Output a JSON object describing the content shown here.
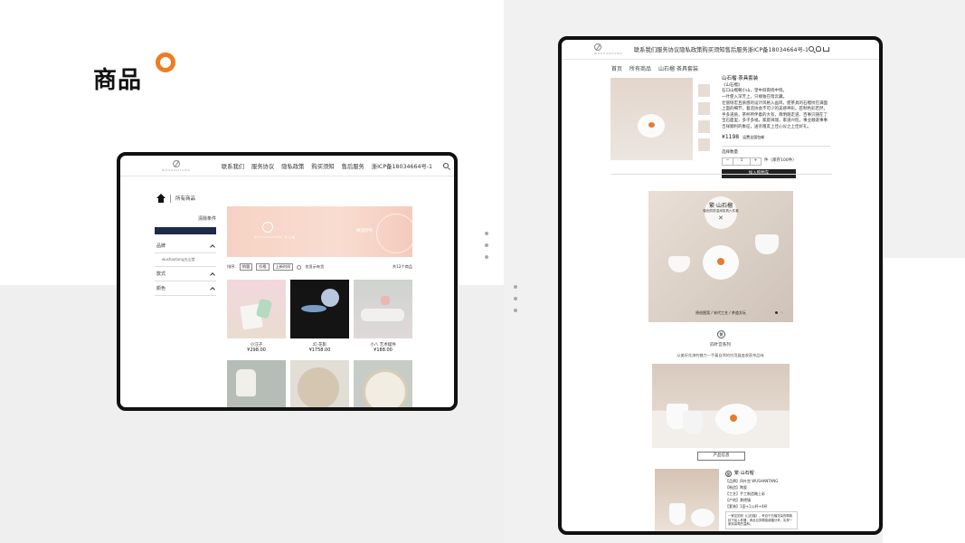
{
  "section": {
    "title": "商品"
  },
  "nav": {
    "brand": "WUSHANTANG",
    "links": [
      "联系我们",
      "服务协议",
      "隐私政策",
      "购买须知",
      "售后服务",
      "浙ICP备18034664号-1"
    ],
    "icons": [
      "search-icon",
      "user-icon",
      "cart-icon"
    ]
  },
  "listing": {
    "breadcrumb": "所有商品",
    "sidebar": {
      "clear_label": "清除条件",
      "groups": [
        {
          "label": "品牌",
          "items": [
            "wushantang五山堂"
          ]
        },
        {
          "label": "款式",
          "items": []
        },
        {
          "label": "颜色",
          "items": []
        }
      ]
    },
    "banner": {
      "tag": "WUSHANTANG 五山堂",
      "text": "精选好物"
    },
    "filters": {
      "sort_label": "排序:",
      "options": [
        "销量",
        "价格",
        "上新时间"
      ],
      "stock_label": "仅显示有货",
      "count": "共12个商品"
    },
    "products": [
      {
        "name": "小汪子",
        "price": "¥298.00"
      },
      {
        "name": "幻·花影",
        "price": "¥1758.00"
      },
      {
        "name": "小八 艺术摆件",
        "price": "¥188.00"
      },
      {
        "name": "",
        "price": ""
      },
      {
        "name": "",
        "price": ""
      },
      {
        "name": "",
        "price": ""
      }
    ]
  },
  "detail": {
    "breadcrumb": [
      "首页",
      "所有商品",
      "山石榴 茶具套装"
    ],
    "title": "山石榴·茶具套装",
    "subtitle": "《山石榴》",
    "lines": [
      "石口山榴朝小山，望中斜雨绕中残。",
      "一叶使入深芳上，只缘独在暗云藏。"
    ],
    "description": "壮丽恢宏且质感的设计风格入画风，使茶具的石榴纹在满面上面的细节，着造协会不可少的美感神彩。匠制色彩若然，手多道质，茶杯所伴着的大有，简明随走道，百事只随在了宝石面里，多子多福，家庭祥瑞，家道兴旺，事业顺遂事事吉祥顺利的象征，送亲赠友上佳心仪之上佳好礼。",
    "price": "¥1198",
    "price_note": "运费全国包邮",
    "qty_label": "选择数量",
    "qty_minus": "−",
    "qty_value": "1",
    "qty_plus": "+",
    "stock": "件（库存100件）",
    "add_to_cart": "加入购物车",
    "hero": {
      "logo_char": "繁",
      "title": "繁·山石榴",
      "subtitle": "釉色丽质温润茶具六件套",
      "close": "✕",
      "caption": "原创图案 / 宋代工艺 / 茶道文玩"
    },
    "series_logo": "繁",
    "series_title": "四叶宫系列",
    "series_desc": "从美好花漆的魅力—手着自然的饮用器皿收获茶品味",
    "info_button": "产品信息",
    "spec": {
      "title": "繁·山石榴",
      "rows": [
        "【品牌】四叶宫 WUSHANTANG",
        "【制造】陶瓷",
        "【工艺】手工制造釉上彩",
        "【产地】景德镇",
        "【套装】1壶+1公杯+4杯"
      ],
      "note": "一家友如何《山石榴》，来自于石榴花朵的精致纹下绘入杯器，承此见多颗感谢福分来，实现一家欢喜寿的温和。"
    }
  }
}
